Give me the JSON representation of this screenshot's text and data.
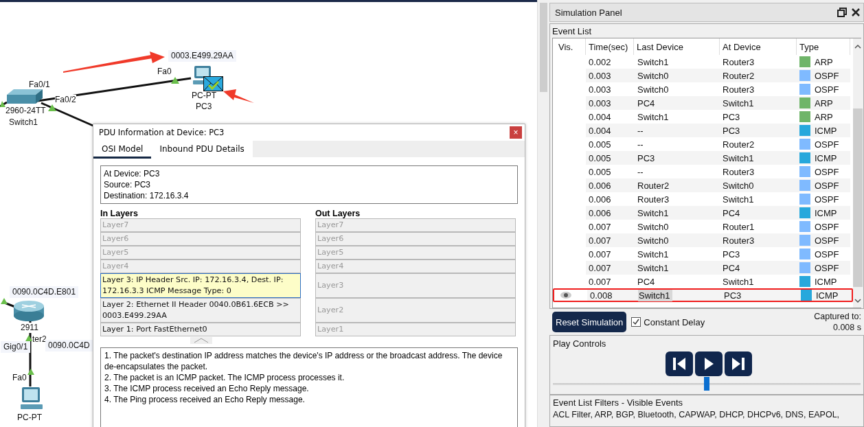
{
  "canvas": {
    "labels": [
      "0003.E499.29AA",
      "Fa0",
      "PC-PT",
      "PC3",
      "Fa0/1",
      "Fa0/2",
      "2960-24TT",
      "Switch1",
      "0090.0C4D.E801",
      "2911",
      "ter2",
      "Gig0/1",
      "0090.0C4D",
      "Fa0",
      "PC-PT"
    ]
  },
  "pdu_dialog": {
    "title": "PDU Information at Device: PC3",
    "close": "×",
    "tabs": [
      {
        "label": "OSI Model",
        "selected": true
      },
      {
        "label": "Inbound PDU Details",
        "selected": false
      }
    ],
    "info": [
      "At Device: PC3",
      "Source: PC3",
      "Destination: 172.16.3.4"
    ],
    "in_title": "In Layers",
    "out_title": "Out Layers",
    "layers": [
      {
        "in": {
          "text": "Layer7",
          "disabled": true,
          "selected": false
        },
        "out": {
          "text": "Layer7",
          "disabled": true
        }
      },
      {
        "in": {
          "text": "Layer6",
          "disabled": true,
          "selected": false
        },
        "out": {
          "text": "Layer6",
          "disabled": true
        }
      },
      {
        "in": {
          "text": "Layer5",
          "disabled": true,
          "selected": false
        },
        "out": {
          "text": "Layer5",
          "disabled": true
        }
      },
      {
        "in": {
          "text": "Layer4",
          "disabled": true,
          "selected": false
        },
        "out": {
          "text": "Layer4",
          "disabled": true
        }
      },
      {
        "in": {
          "text": "Layer 3: IP Header Src. IP: 172.16.3.4, Dest. IP: 172.16.3.3 ICMP Message Type: 0",
          "disabled": false,
          "selected": true
        },
        "out": {
          "text": "Layer3",
          "disabled": true
        }
      },
      {
        "in": {
          "text": "Layer 2: Ethernet II Header 0040.0B61.6ECB >> 0003.E499.29AA",
          "disabled": false,
          "selected": false
        },
        "out": {
          "text": "Layer2",
          "disabled": true
        }
      },
      {
        "in": {
          "text": "Layer 1: Port FastEthernet0",
          "disabled": false,
          "selected": false
        },
        "out": {
          "text": "Layer1",
          "disabled": true
        }
      }
    ],
    "description": [
      "1. The packet's destination IP address matches the device's IP address or the broadcast address. The device de-encapsulates the packet.",
      "2. The packet is an ICMP packet. The ICMP process processes it.",
      "3. The ICMP process received an Echo Reply message.",
      "4. The Ping process received an Echo Reply message."
    ]
  },
  "simulation_panel": {
    "title": "Simulation Panel",
    "event_list_label": "Event List",
    "columns": [
      "Vis.",
      "Time(sec)",
      "Last Device",
      "At Device",
      "Type"
    ],
    "events": [
      {
        "time": "0.002",
        "last": "Switch1",
        "at": "Router3",
        "type": "ARP",
        "color": "#6fb569",
        "selected": false
      },
      {
        "time": "0.003",
        "last": "Switch0",
        "at": "Router2",
        "type": "OSPF",
        "color": "#7fbaff",
        "selected": false
      },
      {
        "time": "0.003",
        "last": "Switch0",
        "at": "Router3",
        "type": "OSPF",
        "color": "#7fbaff",
        "selected": false
      },
      {
        "time": "0.003",
        "last": "PC4",
        "at": "Switch1",
        "type": "ARP",
        "color": "#6fb569",
        "selected": false
      },
      {
        "time": "0.004",
        "last": "Switch1",
        "at": "PC3",
        "type": "ARP",
        "color": "#6fb569",
        "selected": false
      },
      {
        "time": "0.004",
        "last": "--",
        "at": "PC3",
        "type": "ICMP",
        "color": "#27a8dc",
        "selected": false
      },
      {
        "time": "0.005",
        "last": "--",
        "at": "Router2",
        "type": "OSPF",
        "color": "#7fbaff",
        "selected": false
      },
      {
        "time": "0.005",
        "last": "PC3",
        "at": "Switch1",
        "type": "ICMP",
        "color": "#27a8dc",
        "selected": false
      },
      {
        "time": "0.005",
        "last": "--",
        "at": "Router3",
        "type": "OSPF",
        "color": "#7fbaff",
        "selected": false
      },
      {
        "time": "0.006",
        "last": "Router2",
        "at": "Switch0",
        "type": "OSPF",
        "color": "#7fbaff",
        "selected": false
      },
      {
        "time": "0.006",
        "last": "Router3",
        "at": "Switch1",
        "type": "OSPF",
        "color": "#7fbaff",
        "selected": false
      },
      {
        "time": "0.006",
        "last": "Switch1",
        "at": "PC4",
        "type": "ICMP",
        "color": "#27a8dc",
        "selected": false
      },
      {
        "time": "0.007",
        "last": "Switch0",
        "at": "Router1",
        "type": "OSPF",
        "color": "#7fbaff",
        "selected": false
      },
      {
        "time": "0.007",
        "last": "Switch0",
        "at": "Router3",
        "type": "OSPF",
        "color": "#7fbaff",
        "selected": false
      },
      {
        "time": "0.007",
        "last": "Switch1",
        "at": "PC3",
        "type": "OSPF",
        "color": "#7fbaff",
        "selected": false
      },
      {
        "time": "0.007",
        "last": "Switch1",
        "at": "PC4",
        "type": "OSPF",
        "color": "#7fbaff",
        "selected": false
      },
      {
        "time": "0.007",
        "last": "PC4",
        "at": "Switch1",
        "type": "ICMP",
        "color": "#27a8dc",
        "selected": false
      },
      {
        "time": "0.008",
        "last": "Switch1",
        "at": "PC3",
        "type": "ICMP",
        "color": "#27a8dc",
        "selected": true
      }
    ],
    "reset_button": "Reset Simulation",
    "constant_delay": {
      "label": "Constant Delay",
      "checked": true
    },
    "captured_label": "Captured to:",
    "captured_value": "0.008 s",
    "play_controls_label": "Play Controls",
    "playback": {
      "level": 0.5
    },
    "filters_label": "Event List Filters - Visible Events",
    "filters": "ACL Filter, ARP, BGP, Bluetooth, CAPWAP, DHCP, DHCPv6, DNS, EAPOL,"
  }
}
